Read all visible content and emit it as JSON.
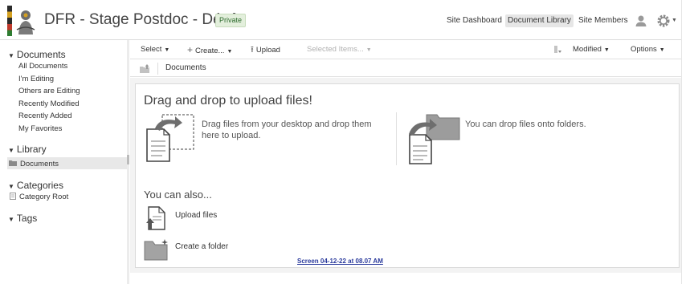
{
  "header": {
    "site_title": "DFR - Stage Postdoc - Dépôt",
    "private_badge": "Private",
    "nav": [
      "Site Dashboard",
      "Document Library",
      "Site Members"
    ],
    "active_nav": "Document Library"
  },
  "toolbar": {
    "select": "Select",
    "create": "Create...",
    "upload": "Upload",
    "selected_items": "Selected Items...",
    "sort": "Modified",
    "options": "Options"
  },
  "breadcrumb": {
    "path": "Documents"
  },
  "sidebar": {
    "documents_heading": "Documents",
    "documents_items": [
      "All Documents",
      "I'm Editing",
      "Others are Editing",
      "Recently Modified",
      "Recently Added",
      "My Favorites"
    ],
    "library_heading": "Library",
    "library_items": [
      "Documents"
    ],
    "categories_heading": "Categories",
    "categories_items": [
      "Category Root"
    ],
    "tags_heading": "Tags"
  },
  "main": {
    "drag_heading": "Drag and drop to upload files!",
    "drag_desc": "Drag files from your desktop and drop them here to upload.",
    "folder_desc": "You can drop files onto folders.",
    "also_heading": "You can also...",
    "actions": [
      "Upload files",
      "Create a folder"
    ]
  },
  "caption": "Screen 04-12-22 at 08.07 AM",
  "icons": {
    "logo": "site-logo",
    "user": "user-icon",
    "gear": "gear-icon",
    "upload": "upload-arrow-icon",
    "create": "plus-icon",
    "sort": "sort-icon",
    "folder_up": "folder-up-icon",
    "folder": "folder-icon",
    "document": "document-icon"
  },
  "colors": {
    "accent_badge_bg": "#e3efdc",
    "accent_badge_text": "#2d6b2d",
    "active_nav_bg": "#e6e6e6",
    "caption_link": "#2a3a9c"
  }
}
